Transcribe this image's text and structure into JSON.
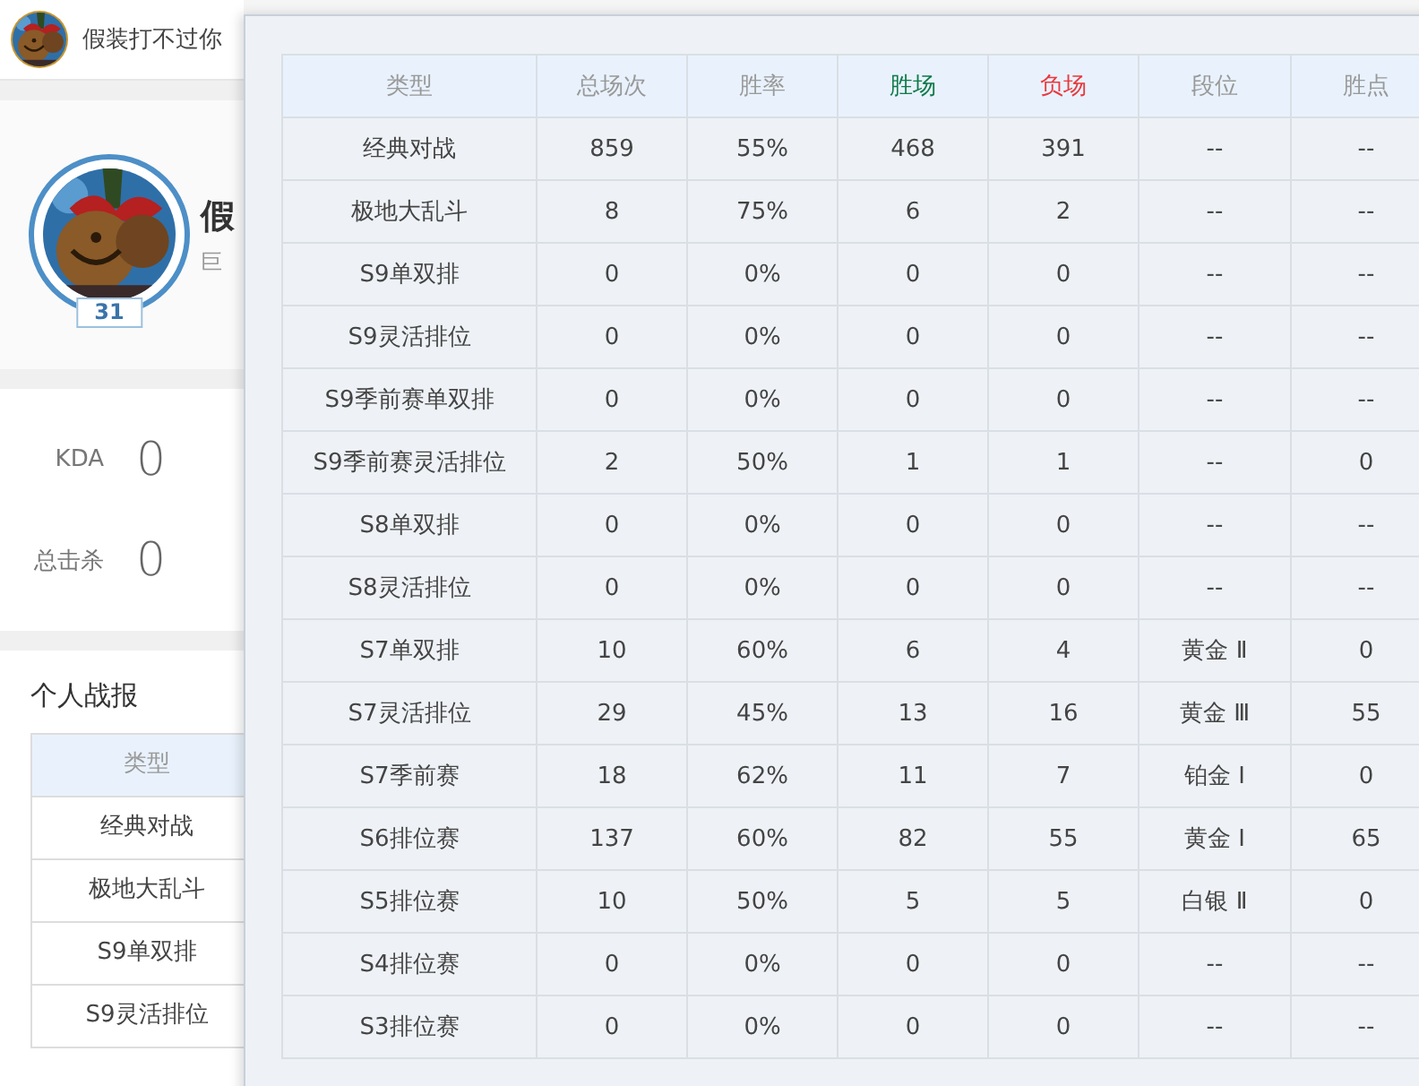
{
  "page": {
    "header": {
      "username": "假装打不过你"
    },
    "profile": {
      "level": "31",
      "name": "假",
      "subtitle": "巨"
    },
    "stats": [
      {
        "label": "KDA",
        "value": "0"
      },
      {
        "label": "总击杀",
        "value": "0"
      }
    ],
    "report": {
      "title": "个人战报",
      "column": "类型",
      "rows": [
        "经典对战",
        "极地大乱斗",
        "S9单双排",
        "S9灵活排位"
      ]
    }
  },
  "popup": {
    "table": {
      "columns": [
        {
          "label": "类型"
        },
        {
          "label": "总场次"
        },
        {
          "label": "胜率"
        },
        {
          "label": "胜场",
          "color": "#0e7a4a"
        },
        {
          "label": "负场",
          "color": "#e8393f"
        },
        {
          "label": "段位"
        },
        {
          "label": "胜点"
        }
      ],
      "rows": [
        [
          "经典对战",
          "859",
          "55%",
          "468",
          "391",
          "--",
          "--"
        ],
        [
          "极地大乱斗",
          "8",
          "75%",
          "6",
          "2",
          "--",
          "--"
        ],
        [
          "S9单双排",
          "0",
          "0%",
          "0",
          "0",
          "--",
          "--"
        ],
        [
          "S9灵活排位",
          "0",
          "0%",
          "0",
          "0",
          "--",
          "--"
        ],
        [
          "S9季前赛单双排",
          "0",
          "0%",
          "0",
          "0",
          "--",
          "--"
        ],
        [
          "S9季前赛灵活排位",
          "2",
          "50%",
          "1",
          "1",
          "--",
          "0"
        ],
        [
          "S8单双排",
          "0",
          "0%",
          "0",
          "0",
          "--",
          "--"
        ],
        [
          "S8灵活排位",
          "0",
          "0%",
          "0",
          "0",
          "--",
          "--"
        ],
        [
          "S7单双排",
          "10",
          "60%",
          "6",
          "4",
          "黄金 Ⅱ",
          "0"
        ],
        [
          "S7灵活排位",
          "29",
          "45%",
          "13",
          "16",
          "黄金 Ⅲ",
          "55"
        ],
        [
          "S7季前赛",
          "18",
          "62%",
          "11",
          "7",
          "铂金 Ⅰ",
          "0"
        ],
        [
          "S6排位赛",
          "137",
          "60%",
          "82",
          "55",
          "黄金 Ⅰ",
          "65"
        ],
        [
          "S5排位赛",
          "10",
          "50%",
          "5",
          "5",
          "白银 Ⅱ",
          "0"
        ],
        [
          "S4排位赛",
          "0",
          "0%",
          "0",
          "0",
          "--",
          "--"
        ],
        [
          "S3排位赛",
          "0",
          "0%",
          "0",
          "0",
          "--",
          "--"
        ]
      ]
    }
  }
}
